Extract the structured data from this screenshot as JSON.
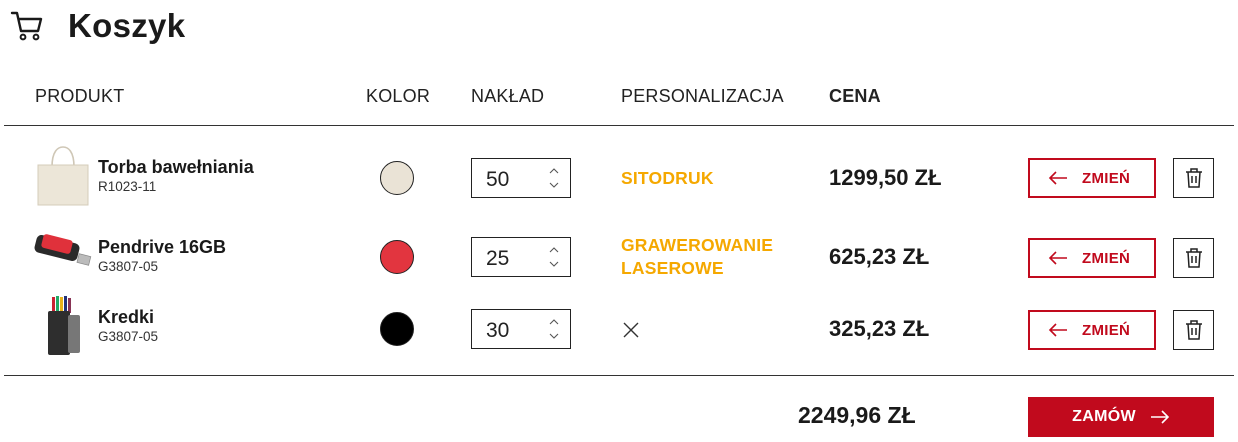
{
  "page": {
    "title": "Koszyk",
    "icon": "cart-icon"
  },
  "columns": {
    "product": "PRODUKT",
    "color": "KOLOR",
    "quantity": "NAKŁAD",
    "personalization": "PERSONALIZACJA",
    "price": "CENA"
  },
  "items": [
    {
      "name": "Torba bawełniania",
      "code": "R1023-11",
      "color": "#eae3d6",
      "color_name": "beige",
      "quantity": "50",
      "personalization": "SITODRUK",
      "price": "1299,50 ZŁ",
      "change_label": "ZMIEŃ",
      "thumb_icon": "tote-bag-image"
    },
    {
      "name": "Pendrive 16GB",
      "code": "G3807-05",
      "color": "#e2353f",
      "color_name": "red",
      "quantity": "25",
      "personalization": "GRAWEROWANIE\nLASEROWE",
      "personalization_line1": "GRAWEROWANIE",
      "personalization_line2": "LASEROWE",
      "price": "625,23 ZŁ",
      "change_label": "ZMIEŃ",
      "thumb_icon": "usb-drive-image"
    },
    {
      "name": "Kredki",
      "code": "G3807-05",
      "color": "#000000",
      "color_name": "black",
      "quantity": "30",
      "personalization": "",
      "personalization_icon": "close-icon",
      "price": "325,23 ZŁ",
      "change_label": "ZMIEŃ",
      "thumb_icon": "crayons-tube-image"
    }
  ],
  "summary": {
    "total": "2249,96 ZŁ",
    "order_label": "ZAMÓW"
  },
  "colors": {
    "accent": "#c10a1d",
    "personalization": "#f5a800",
    "text": "#1a1a1a"
  }
}
